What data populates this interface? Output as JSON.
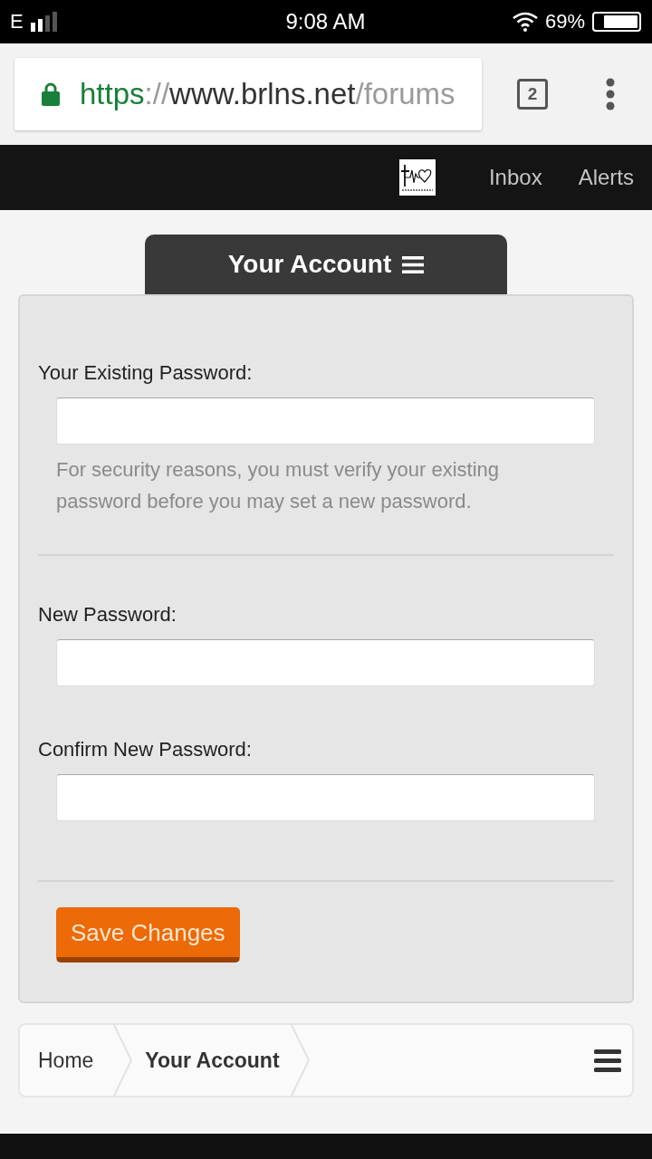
{
  "status_bar": {
    "network": "E",
    "time": "9:08 AM",
    "battery": "69%"
  },
  "browser": {
    "url": {
      "scheme": "https",
      "separator": "://",
      "host": "www.brlns.net",
      "path": "/forums"
    },
    "tab_count": "2"
  },
  "nav": {
    "items": [
      {
        "label": "Inbox"
      },
      {
        "label": "Alerts"
      }
    ]
  },
  "section_tab": {
    "title": "Your Account"
  },
  "form": {
    "groups": [
      {
        "fields": [
          {
            "label": "Your Existing Password:",
            "hint": "For security reasons, you must verify your existing password before you may set a new password."
          }
        ]
      },
      {
        "fields": [
          {
            "label": "New Password:"
          },
          {
            "label": "Confirm New Password:"
          }
        ]
      }
    ],
    "submit": "Save Changes"
  },
  "breadcrumb": {
    "items": [
      {
        "label": "Home",
        "selected": false
      },
      {
        "label": "Your Account",
        "selected": true
      }
    ]
  }
}
